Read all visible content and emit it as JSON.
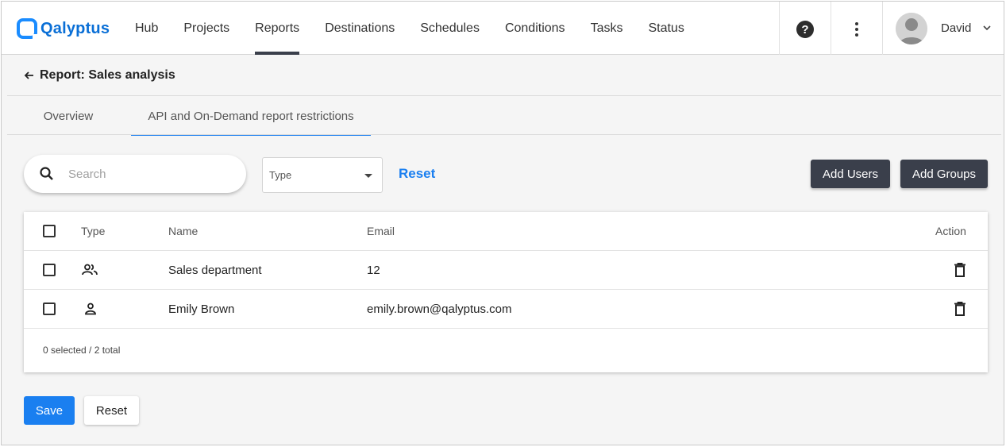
{
  "app": {
    "name": "Qalyptus",
    "brand_color": "#1a8cff"
  },
  "nav": {
    "items": [
      {
        "label": "Hub"
      },
      {
        "label": "Projects"
      },
      {
        "label": "Reports",
        "active": true
      },
      {
        "label": "Destinations"
      },
      {
        "label": "Schedules"
      },
      {
        "label": "Conditions"
      },
      {
        "label": "Tasks"
      },
      {
        "label": "Status"
      }
    ]
  },
  "header": {
    "help_icon": "help-circle-icon",
    "menu_icon": "more-vertical-icon",
    "user_name": "David"
  },
  "breadcrumb": {
    "back_icon": "arrow-left-icon",
    "title": "Report: Sales analysis"
  },
  "tabs": [
    {
      "label": "Overview",
      "active": false
    },
    {
      "label": "API and On-Demand report restrictions",
      "active": true
    }
  ],
  "filters": {
    "search_placeholder": "Search",
    "type_label": "Type",
    "reset_label": "Reset",
    "add_users_label": "Add Users",
    "add_groups_label": "Add Groups"
  },
  "table": {
    "columns": {
      "type": "Type",
      "name": "Name",
      "email": "Email",
      "action": "Action"
    },
    "rows": [
      {
        "type_icon": "group-icon",
        "name": "Sales department",
        "email": "12"
      },
      {
        "type_icon": "user-icon",
        "name": "Emily Brown",
        "email": "emily.brown@qalyptus.com"
      }
    ],
    "footer": "0 selected / 2 total"
  },
  "actions": {
    "save_label": "Save",
    "reset_label": "Reset"
  },
  "colors": {
    "accent": "#1a7ff0",
    "dark_button": "#3a3f4b"
  }
}
